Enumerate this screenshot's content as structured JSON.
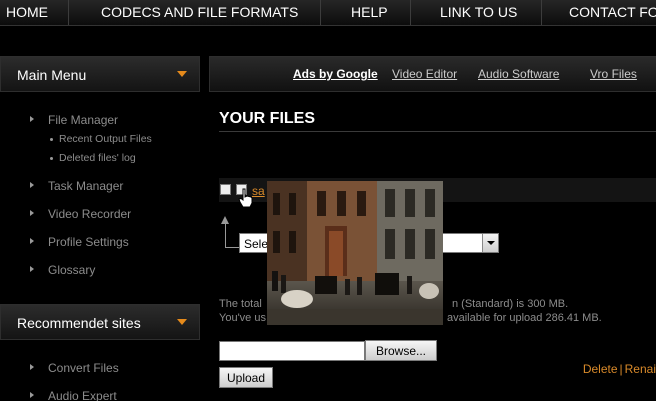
{
  "topnav": {
    "items": [
      {
        "label": "HOME"
      },
      {
        "label": "CODECS AND FILE FORMATS"
      },
      {
        "label": "HELP"
      },
      {
        "label": "LINK TO US"
      },
      {
        "label": "CONTACT FO"
      }
    ]
  },
  "sidebar": {
    "main_menu": {
      "title": "Main Menu",
      "items": [
        {
          "label": "File Manager",
          "subitems": [
            "Recent Output Files",
            "Deleted files' log"
          ]
        },
        {
          "label": "Task Manager"
        },
        {
          "label": "Video Recorder"
        },
        {
          "label": "Profile Settings"
        },
        {
          "label": "Glossary"
        }
      ]
    },
    "recommended": {
      "title": "Recommendet sites",
      "items": [
        {
          "label": "Convert Files"
        },
        {
          "label": "Audio Expert"
        }
      ]
    }
  },
  "ads": {
    "label": "Ads by Google",
    "links": [
      "Video Editor",
      "Audio Software",
      "Vro Files"
    ]
  },
  "main": {
    "title": "YOUR FILES",
    "file": {
      "name_fragment": "sa",
      "actions": {
        "delete": "Delete",
        "separator": "|",
        "rename": "Renai"
      }
    },
    "select": {
      "value": "Sele"
    },
    "info": {
      "line1_left": "The total",
      "line1_right": "n (Standard) is 300 MB.",
      "line2_left": "You've us",
      "line2_right": "available for upload 286.41 MB."
    },
    "upload": {
      "browse_label": "Browse...",
      "upload_label": "Upload"
    }
  },
  "colors": {
    "accent": "#e58a1b",
    "link_orange": "#d98a2a",
    "background": "#000000"
  }
}
